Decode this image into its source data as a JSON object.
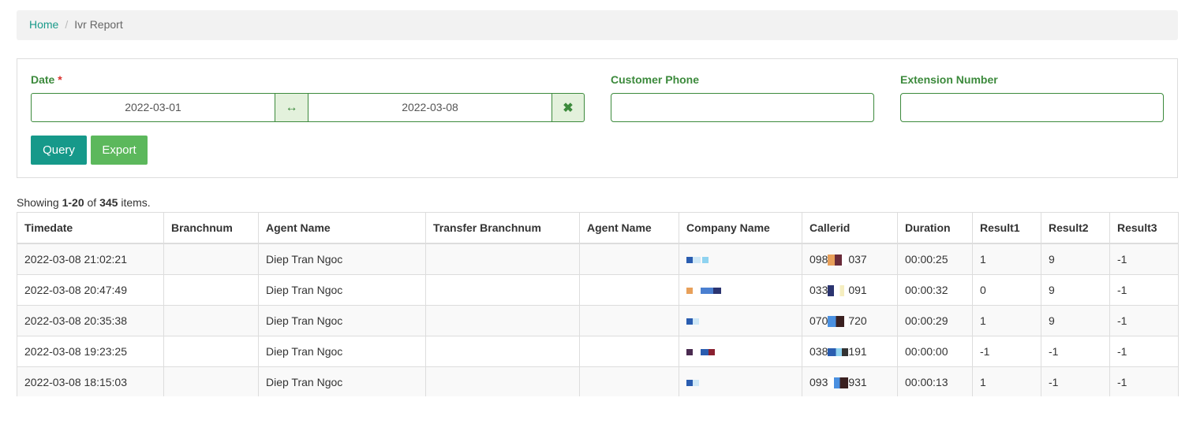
{
  "breadcrumb": {
    "home": "Home",
    "separator": "/",
    "current": "Ivr Report"
  },
  "filters": {
    "date_label": "Date",
    "required_mark": "*",
    "date_from": "2022-03-01",
    "date_to": "2022-03-08",
    "range_icon": "↔",
    "clear_icon": "✖",
    "customer_phone_label": "Customer Phone",
    "customer_phone_value": "",
    "extension_label": "Extension Number",
    "extension_value": "",
    "query_label": "Query",
    "export_label": "Export"
  },
  "summary": {
    "prefix": "Showing ",
    "range": "1-20",
    "of": " of ",
    "total": "345",
    "suffix": " items."
  },
  "table": {
    "headers": [
      "Timedate",
      "Branchnum",
      "Agent Name",
      "Transfer Branchnum",
      "Agent Name",
      "Company Name",
      "Callerid",
      "Duration",
      "Result1",
      "Result2",
      "Result3"
    ],
    "rows": [
      {
        "timedate": "2022-03-08 21:02:21",
        "branchnum": "",
        "agent": "Diep Tran Ngoc",
        "transfer": "",
        "agent2": "",
        "callerid_start": "098",
        "callerid_end": "037",
        "duration": "00:00:25",
        "r1": "1",
        "r2": "9",
        "r3": "-1"
      },
      {
        "timedate": "2022-03-08 20:47:49",
        "branchnum": "",
        "agent": "Diep Tran Ngoc",
        "transfer": "",
        "agent2": "",
        "callerid_start": "033",
        "callerid_end": "091",
        "duration": "00:00:32",
        "r1": "0",
        "r2": "9",
        "r3": "-1"
      },
      {
        "timedate": "2022-03-08 20:35:38",
        "branchnum": "",
        "agent": "Diep Tran Ngoc",
        "transfer": "",
        "agent2": "",
        "callerid_start": "070",
        "callerid_end": "720",
        "duration": "00:00:29",
        "r1": "1",
        "r2": "9",
        "r3": "-1"
      },
      {
        "timedate": "2022-03-08 19:23:25",
        "branchnum": "",
        "agent": "Diep Tran Ngoc",
        "transfer": "",
        "agent2": "",
        "callerid_start": "038",
        "callerid_end": "191",
        "duration": "00:00:00",
        "r1": "-1",
        "r2": "-1",
        "r3": "-1"
      },
      {
        "timedate": "2022-03-08 18:15:03",
        "branchnum": "",
        "agent": "Diep Tran Ngoc",
        "transfer": "",
        "agent2": "",
        "callerid_start": "093",
        "callerid_end": "931",
        "duration": "00:00:13",
        "r1": "1",
        "r2": "-1",
        "r3": "-1"
      }
    ]
  },
  "colors": {
    "accent": "#16998a",
    "export": "#5cb85c",
    "label": "#3c8a3c",
    "required": "#d9302c"
  }
}
